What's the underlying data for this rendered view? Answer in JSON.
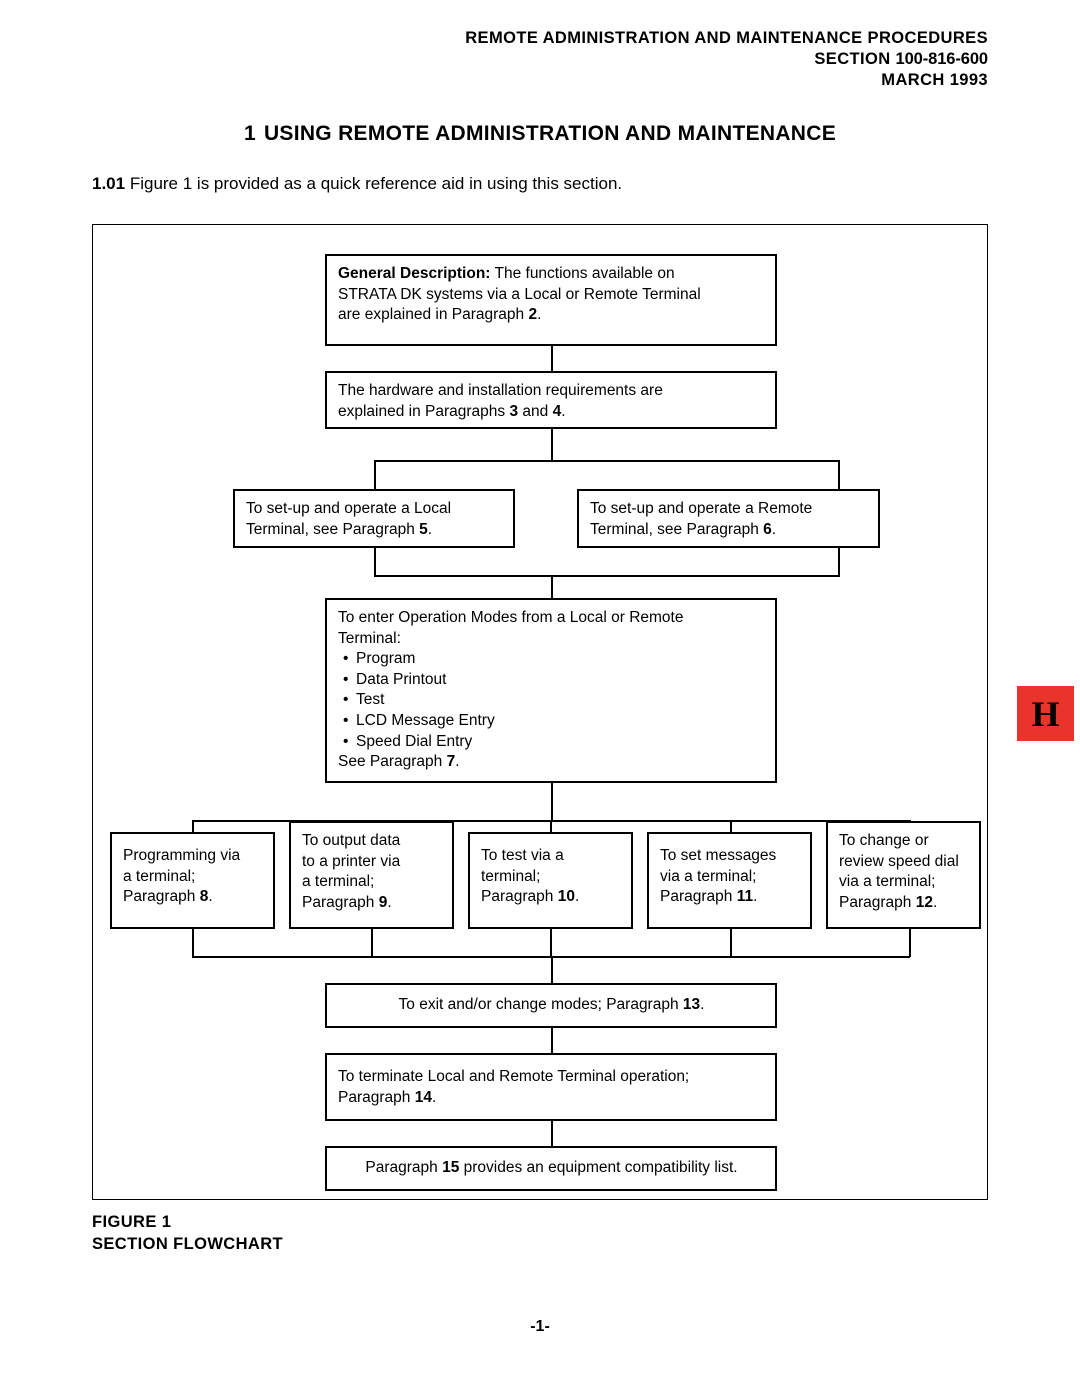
{
  "header": {
    "line1": "REMOTE ADMINISTRATION AND MAINTENANCE PROCEDURES",
    "section_label": "SECTION",
    "section_number": "100-816-600",
    "date": "MARCH 1993"
  },
  "title": {
    "number": "1",
    "text": "USING REMOTE ADMINISTRATION AND MAINTENANCE"
  },
  "intro": {
    "number": "1.01",
    "text": "Figure 1 is provided as a quick reference aid in using this section."
  },
  "tab_marker": "H",
  "flowchart": {
    "boxes": [
      {
        "id": "general-description",
        "label_bold": "General Description:",
        "line1_rest": " The functions available on",
        "line2": "STRATA DK systems via a Local or Remote Terminal",
        "line3_pre": "are explained in Paragraph ",
        "line3_bold": "2",
        "line3_post": "."
      },
      {
        "id": "hardware-installation",
        "line1": "The hardware and installation requirements are",
        "line2_pre": "explained in Paragraphs ",
        "line2_bold1": "3",
        "line2_mid": " and ",
        "line2_bold2": "4",
        "line2_post": "."
      },
      {
        "id": "local-terminal",
        "line1": "To set-up and operate a Local",
        "line2_pre": "Terminal, see Paragraph ",
        "line2_bold": "5",
        "line2_post": "."
      },
      {
        "id": "remote-terminal",
        "line1": "To set-up and operate a Remote",
        "line2_pre": "Terminal, see Paragraph ",
        "line2_bold": "6",
        "line2_post": "."
      },
      {
        "id": "operation-modes",
        "line1": "To enter Operation Modes from a Local or Remote",
        "line2": "Terminal:",
        "bullets": [
          "Program",
          "Data Printout",
          "Test",
          "LCD Message Entry",
          "Speed Dial Entry"
        ],
        "footer_pre": "See Paragraph ",
        "footer_bold": "7",
        "footer_post": "."
      },
      {
        "id": "programming-terminal",
        "line1": "Programming via",
        "line2": "a terminal;",
        "line3_pre": "Paragraph ",
        "line3_bold": "8",
        "line3_post": "."
      },
      {
        "id": "output-printer",
        "line1": "To output data",
        "line2": "to a printer via",
        "line3": "a terminal;",
        "line4_pre": "Paragraph ",
        "line4_bold": "9",
        "line4_post": "."
      },
      {
        "id": "test-terminal",
        "line1": "To test via a",
        "line2": "terminal;",
        "line3_pre": "Paragraph ",
        "line3_bold": "10",
        "line3_post": "."
      },
      {
        "id": "set-messages",
        "line1": "To set messages",
        "line2": "via a terminal;",
        "line3_pre": "Paragraph ",
        "line3_bold": "11",
        "line3_post": "."
      },
      {
        "id": "speed-dial",
        "line1": "To change or",
        "line2": "review speed dial",
        "line3": "via a terminal;",
        "line4_pre": "Paragraph ",
        "line4_bold": "12",
        "line4_post": "."
      },
      {
        "id": "exit-change-modes",
        "line1_pre": "To exit and/or change modes; Paragraph ",
        "line1_bold": "13",
        "line1_post": "."
      },
      {
        "id": "terminate-operation",
        "line1": "To terminate Local and Remote Terminal operation;",
        "line2_pre": "Paragraph ",
        "line2_bold": "14",
        "line2_post": "."
      },
      {
        "id": "compatibility-list",
        "line1_pre": "Paragraph ",
        "line1_bold": "15",
        "line1_post": " provides an equipment compatibility list."
      }
    ]
  },
  "figure_caption": {
    "line1_label": "FIGURE",
    "line1_number": "1",
    "line2": "SECTION FLOWCHART"
  },
  "footer": {
    "page": "-1-"
  }
}
